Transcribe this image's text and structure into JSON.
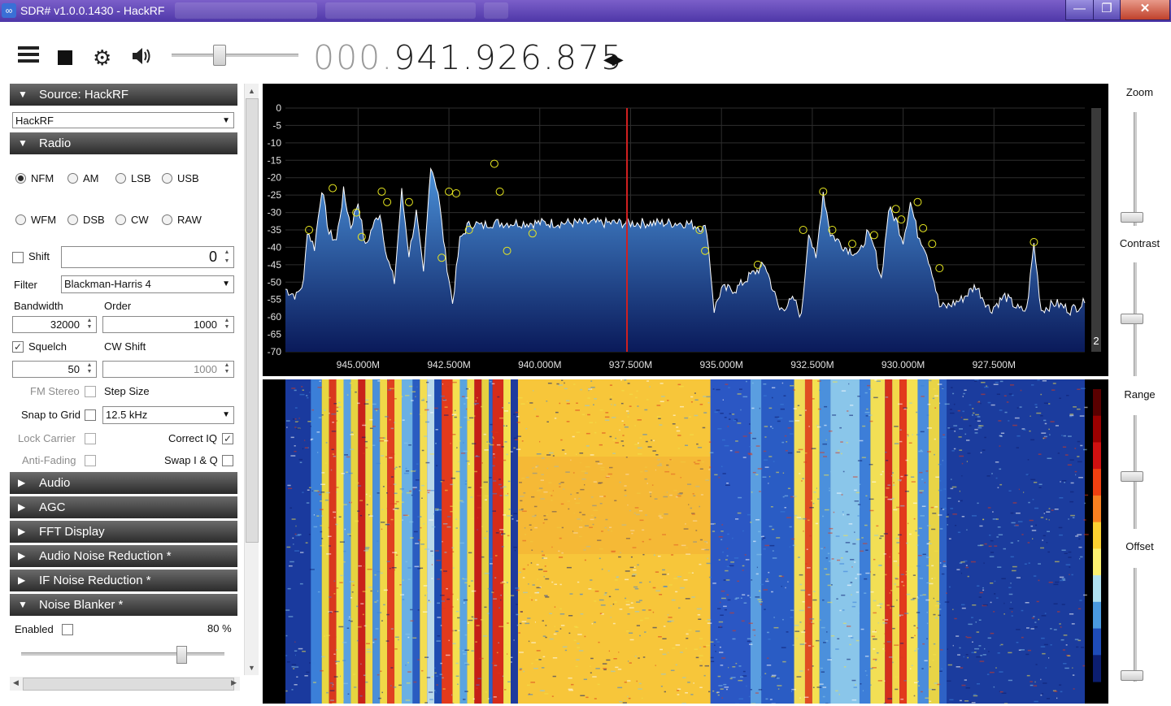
{
  "window": {
    "title": "SDR# v1.0.0.1430 - HackRF",
    "controls": {
      "minimize": "—",
      "maximize": "❐",
      "close": "✕"
    }
  },
  "toolbar": {
    "frequency_dim": "000.",
    "frequency_main": "941.926.875",
    "volume_level": 0.38
  },
  "panels": {
    "source": {
      "header": "Source: HackRF",
      "device": "HackRF"
    },
    "radio": {
      "header": "Radio",
      "modes_row1": [
        "NFM",
        "AM",
        "LSB",
        "USB"
      ],
      "modes_row2": [
        "WFM",
        "DSB",
        "CW",
        "RAW"
      ],
      "selected_mode": "NFM",
      "shift_label": "Shift",
      "shift_value": "0",
      "filter_label": "Filter",
      "filter_value": "Blackman-Harris 4",
      "bandwidth_label": "Bandwidth",
      "bandwidth_value": "32000",
      "order_label": "Order",
      "order_value": "1000",
      "squelch_label": "Squelch",
      "squelch_value": "50",
      "cw_shift_label": "CW Shift",
      "cw_shift_value": "1000",
      "fm_stereo_label": "FM Stereo",
      "step_size_label": "Step Size",
      "snap_label": "Snap to Grid",
      "step_size_value": "12.5 kHz",
      "lock_carrier_label": "Lock Carrier",
      "correct_iq_label": "Correct IQ",
      "anti_fading_label": "Anti-Fading",
      "swap_iq_label": "Swap I & Q"
    },
    "collapsed": [
      "Audio",
      "AGC",
      "FFT Display",
      "Audio Noise Reduction *",
      "IF Noise Reduction *"
    ],
    "noise_blanker": {
      "header": "Noise Blanker *",
      "enabled_label": "Enabled",
      "percent": "80 %",
      "level": 0.8
    }
  },
  "right_panel": {
    "zoom": "Zoom",
    "contrast": "Contrast",
    "range": "Range",
    "offset": "Offset",
    "badge": "2"
  },
  "chart_data": {
    "type": "line",
    "ylabel": "",
    "ylim": [
      -70,
      0
    ],
    "yticks": [
      "0",
      "-5",
      "-10",
      "-15",
      "-20",
      "-25",
      "-30",
      "-35",
      "-40",
      "-45",
      "-50",
      "-55",
      "-60",
      "-65",
      "-70"
    ],
    "xticks": [
      "945.000M",
      "942.500M",
      "940.000M",
      "937.500M",
      "935.000M",
      "932.500M",
      "930.000M",
      "927.500M"
    ],
    "xlim_mhz": [
      947.0,
      925.0
    ],
    "center_mhz": 937.6,
    "series": [
      {
        "x": [
          947.0,
          946.7,
          946.5,
          946.4,
          946.2,
          946.0,
          945.8,
          945.6,
          945.4,
          945.2,
          945.0,
          944.8,
          944.6,
          944.4,
          944.2,
          944.0,
          943.8,
          943.6,
          943.4,
          943.2,
          943.0,
          942.8,
          942.6,
          942.4,
          942.2,
          942.0,
          941.8,
          941.6,
          941.4,
          941.2,
          941.0,
          940.8,
          940.6,
          940.4,
          939.0,
          938.0,
          937.0,
          936.0,
          935.6,
          935.4,
          935.2,
          935.0,
          934.6,
          934.2,
          933.8,
          933.4,
          933.0,
          932.8,
          932.6,
          932.4,
          932.2,
          932.0,
          931.6,
          931.2,
          931.0,
          930.8,
          930.6,
          930.4,
          930.2,
          930.0,
          929.8,
          929.6,
          929.4,
          929.2,
          929.0,
          928.8,
          928.4,
          928.0,
          927.6,
          927.2,
          926.8,
          926.6,
          926.4,
          926.2,
          925.8,
          925.4,
          925.0
        ],
        "y": [
          -52,
          -54,
          -50,
          -35,
          -40,
          -23,
          -36,
          -38,
          -24,
          -34,
          -27,
          -40,
          -34,
          -30,
          -43,
          -50,
          -24,
          -42,
          -30,
          -48,
          -16,
          -24,
          -42,
          -56,
          -38,
          -34,
          -33,
          -34,
          -33,
          -33,
          -33,
          -33,
          -33,
          -33,
          -33,
          -33,
          -33,
          -33,
          -34,
          -35,
          -58,
          -52,
          -52,
          -48,
          -45,
          -58,
          -55,
          -60,
          -35,
          -44,
          -24,
          -36,
          -40,
          -42,
          -36,
          -40,
          -49,
          -29,
          -32,
          -38,
          -27,
          -36,
          -40,
          -47,
          -57,
          -57,
          -55,
          -51,
          -58,
          -54,
          -58,
          -58,
          -39,
          -58,
          -56,
          -58,
          -56
        ]
      }
    ],
    "markers": [
      [
        946.35,
        -35
      ],
      [
        945.7,
        -23
      ],
      [
        945.05,
        -30
      ],
      [
        944.9,
        -37
      ],
      [
        944.35,
        -24
      ],
      [
        944.2,
        -27
      ],
      [
        943.6,
        -27
      ],
      [
        942.7,
        -43
      ],
      [
        942.5,
        -24
      ],
      [
        942.3,
        -24.5
      ],
      [
        941.95,
        -35
      ],
      [
        941.25,
        -16
      ],
      [
        941.1,
        -24
      ],
      [
        940.9,
        -41
      ],
      [
        940.2,
        -36
      ],
      [
        935.6,
        -35
      ],
      [
        935.45,
        -41
      ],
      [
        934.0,
        -45
      ],
      [
        932.75,
        -35
      ],
      [
        932.2,
        -24
      ],
      [
        931.95,
        -35
      ],
      [
        931.4,
        -39
      ],
      [
        930.8,
        -36.5
      ],
      [
        930.2,
        -29
      ],
      [
        930.05,
        -32
      ],
      [
        929.6,
        -27
      ],
      [
        929.45,
        -34.5
      ],
      [
        929.2,
        -39
      ],
      [
        929.0,
        -46
      ],
      [
        926.4,
        -38.5
      ]
    ]
  },
  "waterfall": {
    "bands": [
      [
        946.9,
        946.3,
        "#1a3a9e"
      ],
      [
        946.3,
        946.0,
        "#3b7fd8"
      ],
      [
        946.0,
        945.8,
        "#e8d640"
      ],
      [
        945.8,
        945.6,
        "#d9381e"
      ],
      [
        945.6,
        945.4,
        "#f2e14a"
      ],
      [
        945.4,
        945.2,
        "#5aa0e0"
      ],
      [
        945.2,
        945.0,
        "#e6d440"
      ],
      [
        945.0,
        944.8,
        "#c9221a"
      ],
      [
        944.8,
        944.6,
        "#f0d848"
      ],
      [
        944.6,
        944.4,
        "#4a8fd8"
      ],
      [
        944.4,
        944.2,
        "#f0d848"
      ],
      [
        944.2,
        944.0,
        "#e04020"
      ],
      [
        944.0,
        943.8,
        "#f2dc4c"
      ],
      [
        943.8,
        943.5,
        "#6ab0e4"
      ],
      [
        943.5,
        943.3,
        "#2a5cc0"
      ],
      [
        943.3,
        943.1,
        "#f3dd50"
      ],
      [
        943.1,
        942.9,
        "#b8d8ea"
      ],
      [
        942.9,
        942.7,
        "#1e4cb0"
      ],
      [
        942.7,
        942.4,
        "#e23a1c"
      ],
      [
        942.4,
        942.2,
        "#f4e050"
      ],
      [
        942.2,
        942.0,
        "#5aa4e0"
      ],
      [
        942.0,
        941.8,
        "#f2dc4a"
      ],
      [
        941.8,
        941.6,
        "#c51f17"
      ],
      [
        941.6,
        941.4,
        "#e6d040"
      ],
      [
        941.4,
        941.3,
        "#2c60c4"
      ],
      [
        941.3,
        941.0,
        "#d52c1a"
      ],
      [
        941.0,
        940.8,
        "#f4e050"
      ],
      [
        940.8,
        940.6,
        "#1e3a9e"
      ],
      [
        940.6,
        935.3,
        "#f7c63a"
      ],
      [
        935.3,
        934.2,
        "#2b57c4"
      ],
      [
        934.2,
        933.9,
        "#5a9ee0"
      ],
      [
        933.9,
        933.0,
        "#2a5cc4"
      ],
      [
        933.0,
        932.7,
        "#f0dc58"
      ],
      [
        932.7,
        932.5,
        "#e04e22"
      ],
      [
        932.5,
        932.3,
        "#f4e050"
      ],
      [
        932.3,
        932.0,
        "#4b90dc"
      ],
      [
        932.0,
        931.2,
        "#8ac6ea"
      ],
      [
        931.2,
        930.9,
        "#3d7ed8"
      ],
      [
        930.9,
        930.5,
        "#f2df55"
      ],
      [
        930.5,
        930.3,
        "#d4301c"
      ],
      [
        930.3,
        930.1,
        "#f3d84a"
      ],
      [
        930.1,
        929.9,
        "#e23a1c"
      ],
      [
        929.9,
        929.6,
        "#f5e152"
      ],
      [
        929.6,
        929.3,
        "#4a8cdc"
      ],
      [
        929.3,
        929.0,
        "#e8d446"
      ],
      [
        929.0,
        928.8,
        "#2e62c6"
      ],
      [
        928.8,
        925.0,
        "#1b3c9e"
      ]
    ],
    "colorbar": [
      "#5a0000",
      "#9a0000",
      "#d01010",
      "#f04010",
      "#f88020",
      "#fbd030",
      "#fbf070",
      "#b0e0f0",
      "#4a9ae0",
      "#1e4cb8",
      "#0c1e70"
    ]
  }
}
